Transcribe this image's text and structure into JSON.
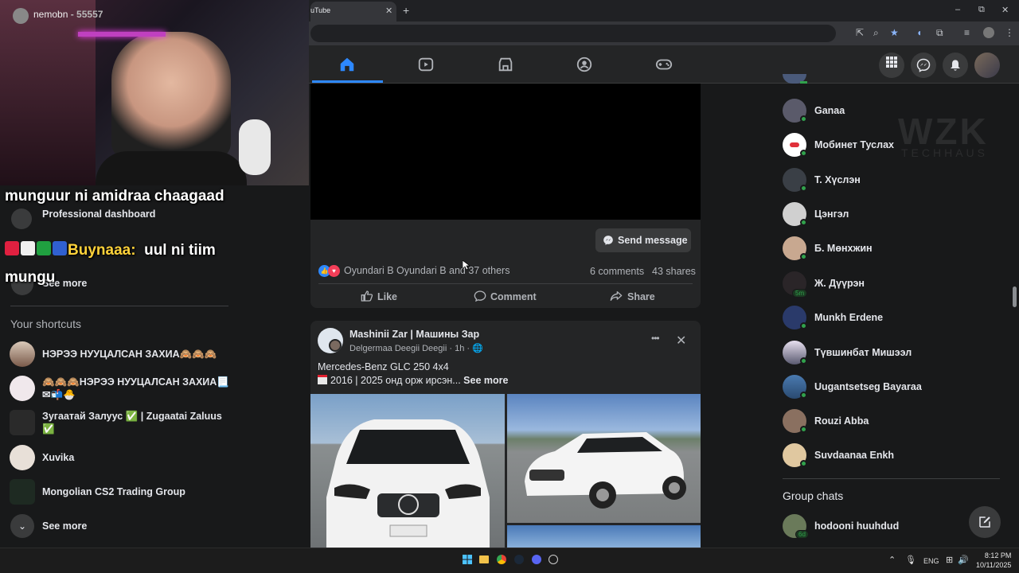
{
  "browser": {
    "tab_title": "uTube",
    "new_tab": "+",
    "close": "✕",
    "win_min": "–",
    "win_max": "⧉",
    "win_close": "✕"
  },
  "webcam": {
    "name": "nemobn",
    "score": "- 55557"
  },
  "overlay": {
    "line1": "munguur ni amidraa chaagaad",
    "speaker": "Buynaaa:",
    "line2": "uul ni tiim",
    "line3": "mungu"
  },
  "left_sidebar": {
    "professional_dashboard": "Professional dashboard",
    "see_more_top": "See more",
    "section_title": "Your shortcuts",
    "shortcuts": [
      {
        "label": "НЭРЭЭ НУУЦАЛСАН ЗАХИА🙈🙈🙈"
      },
      {
        "label": "🙈🙈🙈НЭРЭЭ НУУЦАЛСАН ЗАХИА📃✉📬🐣"
      },
      {
        "label": "Зугаатай Залуус ✅ | Zugaatai Zaluus ✅"
      },
      {
        "label": "Xuvika"
      },
      {
        "label": "Mongolian CS2 Trading Group"
      }
    ],
    "see_more": "See more"
  },
  "post1": {
    "send_message": "Send message",
    "reactions_text": "Oyundari B Oyundari B and 37 others",
    "comments": "6 comments",
    "shares": "43 shares",
    "like": "Like",
    "comment": "Comment",
    "share": "Share"
  },
  "post2": {
    "page_name": "Mashinii Zar | Машины Зар",
    "author": "Delgermaa Deegii Deegii",
    "time": "· 1h ·",
    "line1": "Mercedes-Benz GLC 250 4x4",
    "line2": "2016 | 2025 онд орж ирсэн...",
    "see_more": "See more",
    "more": "•••",
    "close": "✕"
  },
  "contacts": [
    {
      "name": "Ganaa"
    },
    {
      "name": "Мобинет Туслах"
    },
    {
      "name": "Т. Хүслэн"
    },
    {
      "name": "Цэнгэл"
    },
    {
      "name": "Б. Мөнхжин"
    },
    {
      "name": "Ж. Дүүрэн",
      "badge": "5m"
    },
    {
      "name": "Munkh Erdene"
    },
    {
      "name": "Түвшинбат Мишээл"
    },
    {
      "name": "Uugantsetseg Bayaraa"
    },
    {
      "name": "Rouzi Abba"
    },
    {
      "name": "Suvdaanaa Enkh"
    }
  ],
  "watermark": {
    "big": "WZK",
    "small": "TECHHAUS"
  },
  "group_chats": {
    "title": "Group chats",
    "items": [
      {
        "name": "hodooni huuhdud",
        "badge": "6d"
      }
    ]
  },
  "taskbar": {
    "lang": "ENG",
    "time": "8:12 PM",
    "date": "10/11/2025"
  },
  "colors": {
    "accent": "#2d88ff",
    "online": "#31a24c"
  }
}
